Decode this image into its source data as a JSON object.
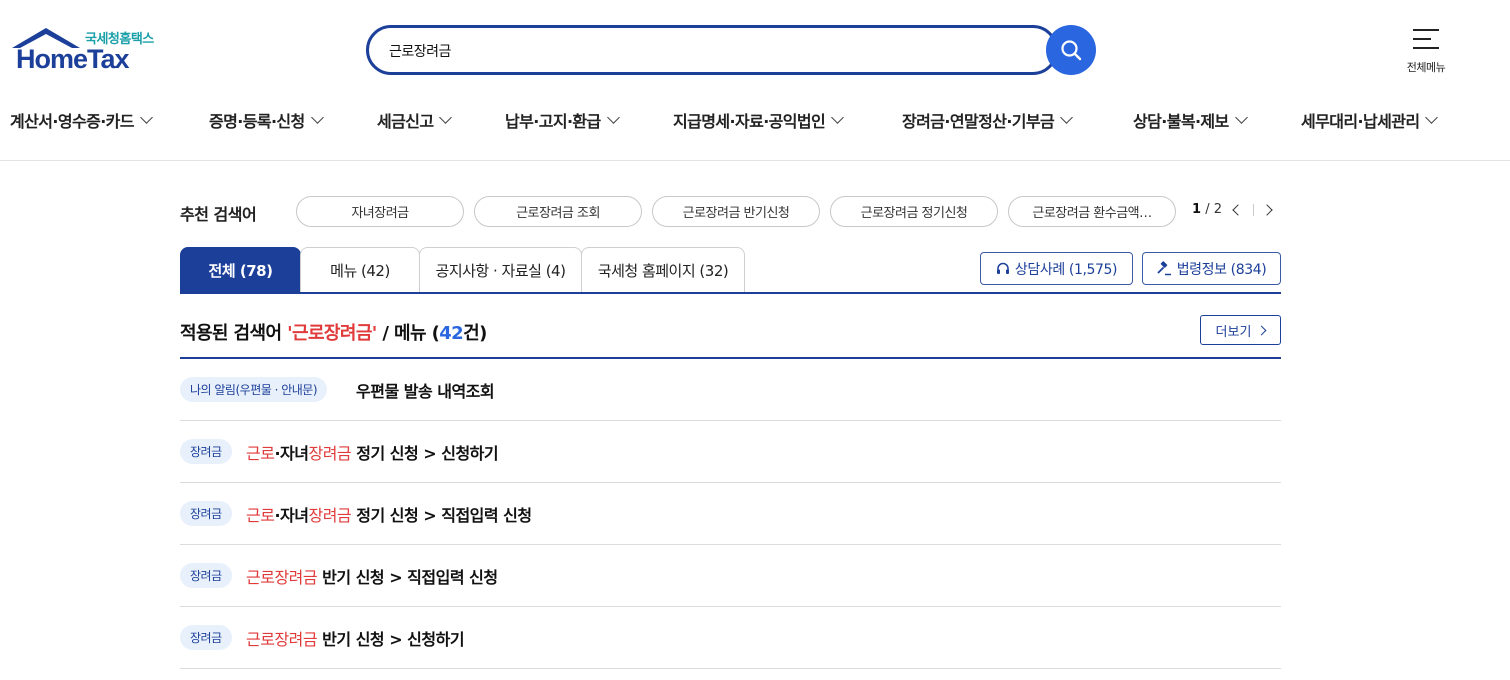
{
  "logo": {
    "subtitle": "국세청홈택스",
    "title": "HomeTax"
  },
  "search": {
    "value": "근로장려금",
    "placeholder": ""
  },
  "all_menu": {
    "label": "전체메뉴"
  },
  "gnb": [
    "계산서·영수증·카드",
    "증명·등록·신청",
    "세금신고",
    "납부·고지·환급",
    "지급명세·자료·공익법인",
    "장려금·연말정산·기부금",
    "상담·불복·제보",
    "세무대리·납세관리"
  ],
  "recommended": {
    "title": "추천 검색어",
    "chips": [
      "자녀장려금",
      "근로장려금 조회",
      "근로장려금 반기신청",
      "근로장려금 정기신청",
      "근로장려금 환수금액…"
    ],
    "page_current": "1",
    "page_total": "/ 2"
  },
  "tabs": [
    "전체 (78)",
    "메뉴 (42)",
    "공지사항 · 자료실 (4)",
    "국세청 홈페이지 (32)"
  ],
  "side_buttons": {
    "consult": "상담사례 (1,575)",
    "law": "법령정보 (834)"
  },
  "result_header": {
    "prefix": "적용된 검색어 ",
    "keyword": "'근로장려금'",
    "middle": " / 메뉴 (",
    "count": "42",
    "suffix": "건)",
    "more": "더보기"
  },
  "results": [
    {
      "badge": "나의 알림(우편물 · 안내문)",
      "hl1": "",
      "mid": "우편물 발송 내역조회",
      "hl2": "",
      "rest": ""
    },
    {
      "badge": "장려금",
      "hl1": "근로",
      "mid": "·자녀",
      "hl2": "장려금",
      "rest": " 정기 신청 > 신청하기"
    },
    {
      "badge": "장려금",
      "hl1": "근로",
      "mid": "·자녀",
      "hl2": "장려금",
      "rest": " 정기 신청 > 직접입력 신청"
    },
    {
      "badge": "장려금",
      "hl1": "근로장려금",
      "mid": " 반기 신청 > 직접입력 신청",
      "hl2": "",
      "rest": ""
    },
    {
      "badge": "장려금",
      "hl1": "근로장려금",
      "mid": " 반기 신청 > 신청하기",
      "hl2": "",
      "rest": ""
    }
  ],
  "colors": {
    "primary": "#1c3f9a",
    "accent_blue": "#2a66e0",
    "highlight_red": "#e03a3a",
    "logo_teal": "#1aa0a8"
  }
}
